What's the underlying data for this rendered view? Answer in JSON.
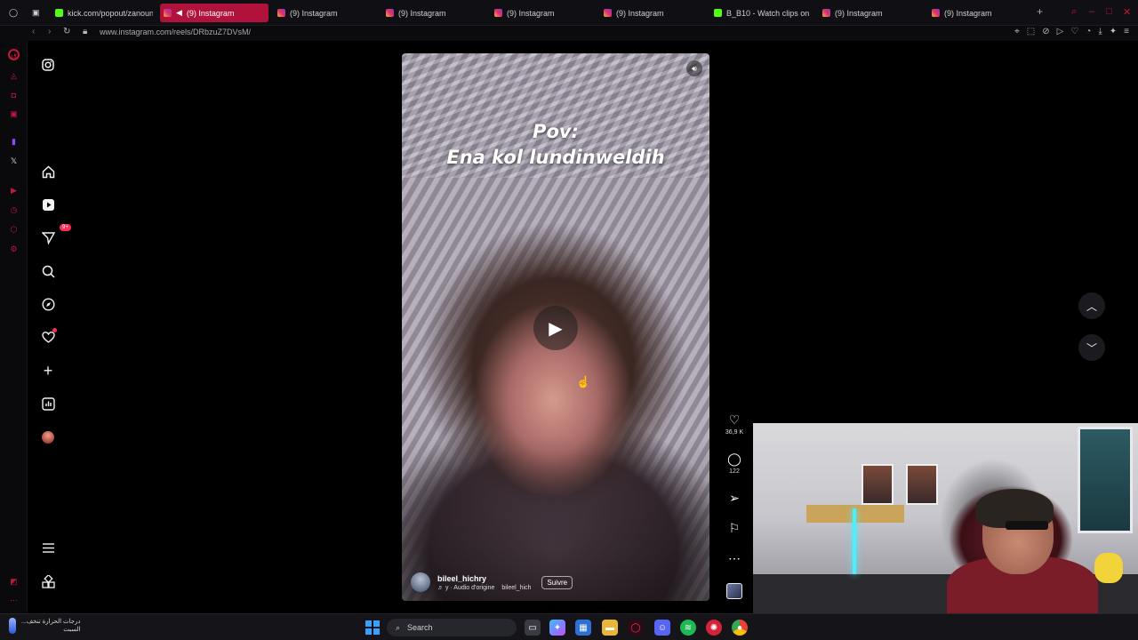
{
  "browser": {
    "tabs": [
      {
        "title": "kick.com/popout/zanoun",
        "icon": "kick-icon",
        "active": false
      },
      {
        "title": "(9) Instagram",
        "icon": "instagram-icon",
        "active": true
      },
      {
        "title": "(9) Instagram",
        "icon": "instagram-icon",
        "active": false
      },
      {
        "title": "(9) Instagram",
        "icon": "instagram-icon",
        "active": false
      },
      {
        "title": "(9) Instagram",
        "icon": "instagram-icon",
        "active": false
      },
      {
        "title": "(9) Instagram",
        "icon": "instagram-icon",
        "active": false
      },
      {
        "title": "B_B10 - Watch clips on K",
        "icon": "kick-icon",
        "active": false
      },
      {
        "title": "(9) Instagram",
        "icon": "instagram-icon",
        "active": false
      },
      {
        "title": "(9) Instagram",
        "icon": "instagram-icon",
        "active": false
      }
    ],
    "url": "www.instagram.com/reels/DRbzuZ7DVsM/",
    "accent_color": "#c2173e"
  },
  "sidebar": {
    "notification_badge": "9+"
  },
  "reel": {
    "caption_line1": "Pov:",
    "caption_line2": "Ena kol lundinweldih",
    "author": "bileel_hichry",
    "audio": "♬ y · Audio d'origine",
    "audio_author": "bileel_hich",
    "follow_label": "Suivre",
    "likes": "36,9 K",
    "comments": "122"
  },
  "taskbar": {
    "weather_line1": "درجات الحرارة تنخف...",
    "weather_line2": "السبت",
    "search_placeholder": "Search"
  }
}
